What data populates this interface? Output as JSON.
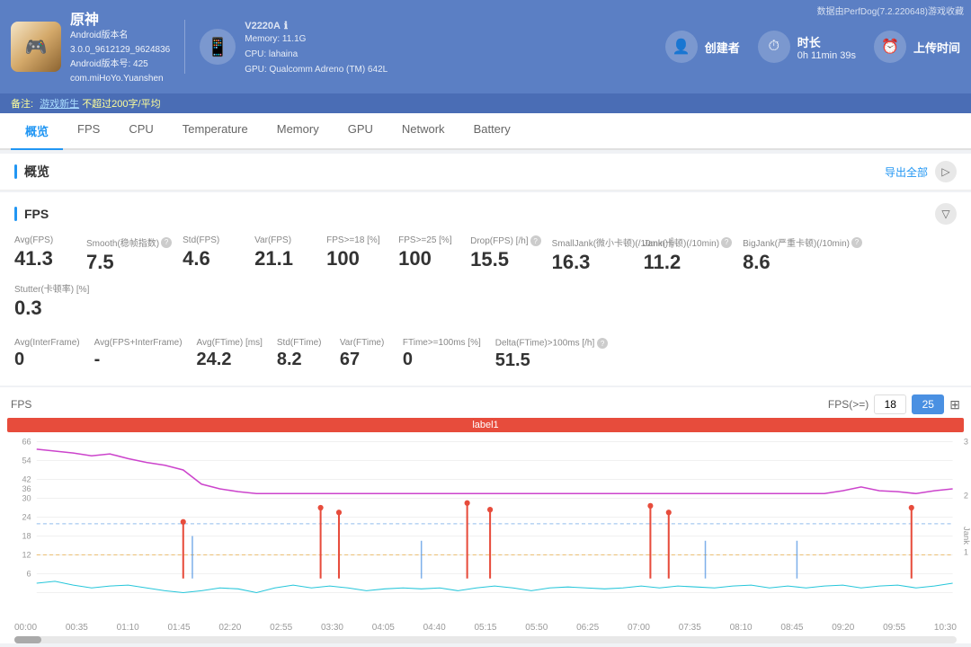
{
  "watermark": "数据由PerfDog(7.2.220648)游戏收藏",
  "header": {
    "app_name": "原神",
    "app_platform": "Android版本名",
    "app_version": "3.0.0_9612129_9624836",
    "app_version2": "Android版本号: 425",
    "app_package": "com.miHoYo.Yuanshen",
    "device_name": "V2220A",
    "device_icon": "ℹ",
    "device_memory": "Memory: 11.1G",
    "device_cpu": "CPU: lahaina",
    "device_gpu": "GPU: Qualcomm Adreno (TM) 642L",
    "creator_label": "创建者",
    "creator_icon": "👤",
    "duration_label": "时长",
    "duration_value": "0h 11min 39s",
    "duration_icon": "⏱",
    "upload_label": "上传时间",
    "upload_icon": "⏰"
  },
  "notes": {
    "prefix": "备注:",
    "link1": "游戏新生",
    "sep1": "不超过200字/平均",
    "link2": ""
  },
  "tabs": [
    {
      "label": "概览",
      "active": true
    },
    {
      "label": "FPS",
      "active": false
    },
    {
      "label": "CPU",
      "active": false
    },
    {
      "label": "Temperature",
      "active": false
    },
    {
      "label": "Memory",
      "active": false
    },
    {
      "label": "GPU",
      "active": false
    },
    {
      "label": "Network",
      "active": false
    },
    {
      "label": "Battery",
      "active": false
    }
  ],
  "overview_section": {
    "title": "概览",
    "export_label": "导出全部"
  },
  "fps_section": {
    "title": "FPS",
    "metrics_row1": [
      {
        "label": "Avg(FPS)",
        "value": "41.3",
        "has_info": false
      },
      {
        "label": "Smooth(稳帧指数)",
        "value": "7.5",
        "has_info": true
      },
      {
        "label": "Std(FPS)",
        "value": "4.6",
        "has_info": false
      },
      {
        "label": "Var(FPS)",
        "value": "21.1",
        "has_info": false
      },
      {
        "label": "FPS>=18 [%]",
        "value": "100",
        "has_info": false
      },
      {
        "label": "FPS>=25 [%]",
        "value": "100",
        "has_info": false
      },
      {
        "label": "Drop(FPS) [/h]",
        "value": "15.5",
        "has_info": true
      },
      {
        "label": "SmallJank(微小卡顿)(/10min)",
        "value": "16.3",
        "has_info": true
      },
      {
        "label": "Jank(卡顿)(/10min)",
        "value": "11.2",
        "has_info": true
      },
      {
        "label": "BigJank(严重卡顿)(/10min)",
        "value": "8.6",
        "has_info": true
      },
      {
        "label": "Stutter(卡顿率) [%]",
        "value": "0.3",
        "has_info": false
      }
    ],
    "metrics_row2": [
      {
        "label": "Avg(InterFrame)",
        "value": "0"
      },
      {
        "label": "Avg(FPS+InterFrame)",
        "value": "-"
      },
      {
        "label": "Avg(FTime) [ms]",
        "value": "24.2"
      },
      {
        "label": "Std(FTime)",
        "value": "8.2"
      },
      {
        "label": "Var(FTime)",
        "value": "67"
      },
      {
        "label": "FTime>=100ms [%]",
        "value": "0"
      },
      {
        "label": "Delta(FTime)>100ms [/h]",
        "value": "51.5",
        "has_info": true
      }
    ],
    "chart": {
      "y_label": "FPS",
      "fps_gte_label": "FPS(>=)",
      "fps_val1": "18",
      "fps_val2": "25",
      "table_icon": "⊞",
      "label_bar": "label1",
      "jank_label": "Jank",
      "y_max": 66,
      "y_ticks": [
        66,
        54,
        42,
        36,
        30,
        24,
        18,
        12,
        6
      ],
      "jank_ticks": [
        3,
        2,
        1
      ],
      "x_labels": [
        "00:00",
        "00:35",
        "01:10",
        "01:45",
        "02:20",
        "02:55",
        "03:30",
        "04:05",
        "04:40",
        "05:15",
        "05:50",
        "06:25",
        "07:00",
        "07:35",
        "08:10",
        "08:45",
        "09:20",
        "09:55",
        "10:30"
      ]
    }
  }
}
